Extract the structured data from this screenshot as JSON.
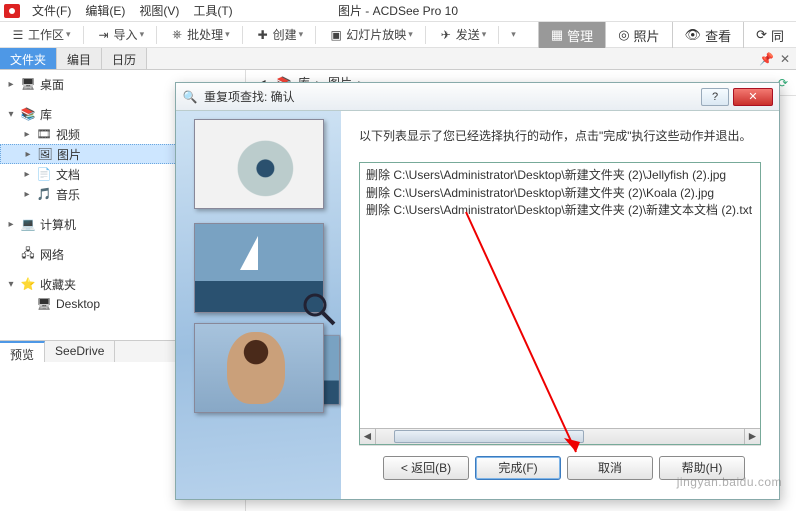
{
  "app_title": "图片 - ACDSee Pro 10",
  "menubar": {
    "file": "文件(F)",
    "edit": "编辑(E)",
    "view": "视图(V)",
    "tools": "工具(T)"
  },
  "toolbar": {
    "workspace": "工作区",
    "import": "导入",
    "batch": "批处理",
    "create": "创建",
    "slideshow": "幻灯片放映",
    "send": "发送"
  },
  "modes": {
    "manage": "管理",
    "photo": "照片",
    "view": "查看",
    "sync": "同"
  },
  "side_tabs": {
    "folders": "文件夹",
    "catalog": "编目",
    "calendar": "日历"
  },
  "tree": {
    "desktop": "桌面",
    "libraries": "库",
    "videos": "视频",
    "pictures": "图片",
    "documents": "文档",
    "music": "音乐",
    "computer": "计算机",
    "network": "网络",
    "favorites": "收藏夹",
    "fav_desktop": "Desktop"
  },
  "bottom_tabs": {
    "preview": "预览",
    "seedrive": "SeeDrive"
  },
  "breadcrumb": {
    "root": "库",
    "current": "图片"
  },
  "dialog": {
    "title": "重复项查找: 确认",
    "instruction": "以下列表显示了您已经选择执行的动作，点击\"完成\"执行这些动作并退出。",
    "items": [
      "删除 C:\\Users\\Administrator\\Desktop\\新建文件夹 (2)\\Jellyfish (2).jpg",
      "删除 C:\\Users\\Administrator\\Desktop\\新建文件夹 (2)\\Koala (2).jpg",
      "删除 C:\\Users\\Administrator\\Desktop\\新建文件夹 (2)\\新建文本文档 (2).txt"
    ],
    "back": "< 返回(B)",
    "finish": "完成(F)",
    "cancel": "取消",
    "help": "帮助(H)",
    "help_icon": "?"
  },
  "watermark": "jingyan.baidu.com"
}
